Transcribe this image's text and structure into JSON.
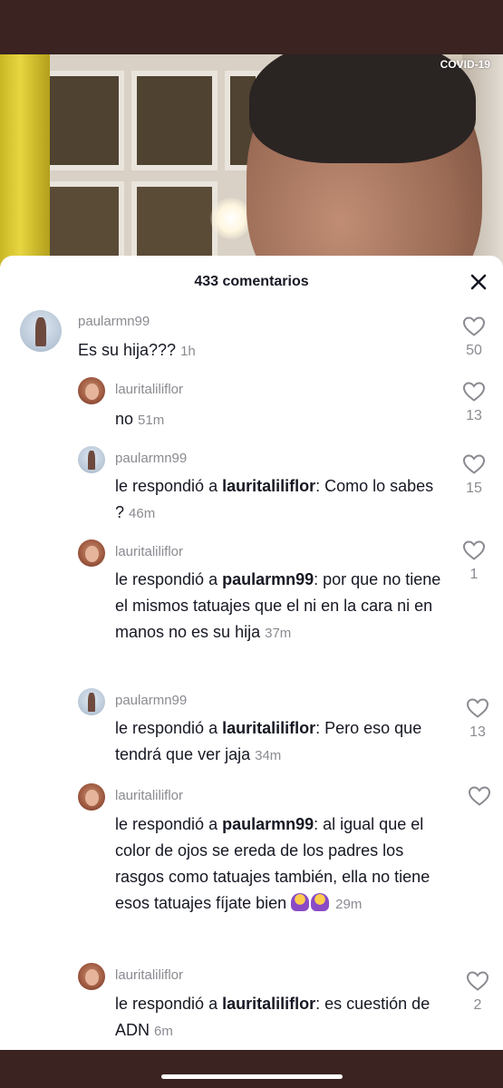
{
  "video": {
    "badge": "COVID-19"
  },
  "comments_panel": {
    "title": "433 comentarios"
  },
  "comments": [
    {
      "username": "paularmn99",
      "text": "Es su hija???",
      "time": "1h",
      "likes": "50"
    },
    {
      "username": "lauritaliliflor",
      "text": "no",
      "time": "51m",
      "likes": "13"
    },
    {
      "username": "paularmn99",
      "prefix": "le respondió a ",
      "mention": "lauritaliliflor",
      "text": ": Como lo sabes ?",
      "time": "46m",
      "likes": "15"
    },
    {
      "username": "lauritaliliflor",
      "prefix": "le respondió a ",
      "mention": "paularmn99",
      "text": ": por que no tiene el mismos tatuajes que el ni en la cara ni en manos no es su hija",
      "time": "37m",
      "likes": "1"
    },
    {
      "username": "paularmn99",
      "prefix": "le respondió a ",
      "mention": "lauritaliliflor",
      "text": ": Pero eso que tendrá que ver jaja",
      "time": "34m",
      "likes": "13"
    },
    {
      "username": "lauritaliliflor",
      "prefix": "le respondió a ",
      "mention": "paularmn99",
      "text": ": al igual que el color de ojos se ereda de los padres los rasgos como tatuajes también, ella no tiene esos tatuajes fíjate bien",
      "time": "29m",
      "likes": ""
    },
    {
      "username": "lauritaliliflor",
      "prefix": "le respondió a ",
      "mention": "lauritaliliflor",
      "text": ": es cuestión de ADN",
      "time": "6m",
      "likes": "2"
    }
  ],
  "icons": {
    "close": "close-icon",
    "like": "heart-outline-icon",
    "emoji": "woman-shrugging-emoji"
  }
}
